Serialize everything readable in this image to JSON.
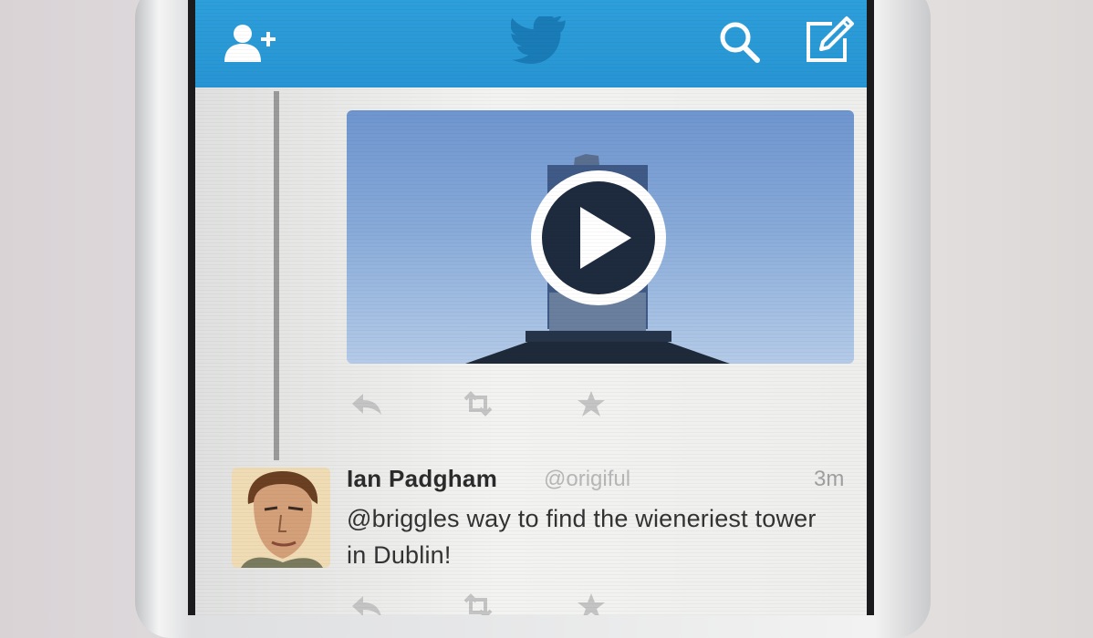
{
  "colors": {
    "nav_bar": "#2d9fdb",
    "nav_icon": "#ffffff",
    "bird_logo": "#1a7cb6",
    "action_icon": "#c4c4c4",
    "text_primary": "#2b2b2b",
    "text_secondary": "#b7b7b7"
  },
  "nav": {
    "icons": [
      "add-user-icon",
      "twitter-bird-icon",
      "search-icon",
      "compose-icon"
    ]
  },
  "video_tweet": {
    "media": "video-thumbnail",
    "actions": [
      "reply-icon",
      "retweet-icon",
      "favorite-icon"
    ]
  },
  "tweet": {
    "name": "Ian Padgham",
    "handle": "@origiful",
    "time": "3m",
    "text": "@briggles way to find the wieneriest tower in Dublin!",
    "actions": [
      "reply-icon",
      "retweet-icon",
      "favorite-icon"
    ]
  }
}
